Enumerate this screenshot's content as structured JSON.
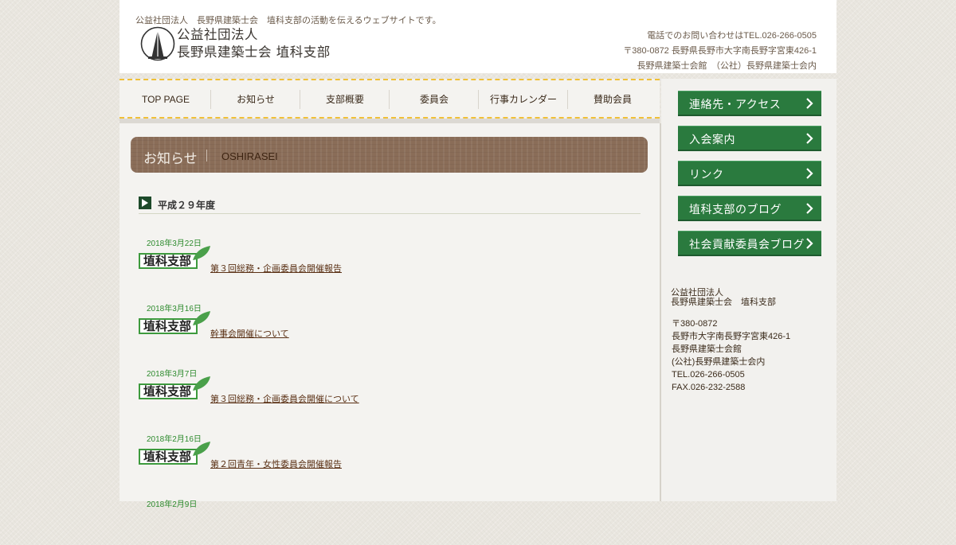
{
  "header": {
    "tagline": "公益社団法人　長野県建築士会　埴科支部の活動を伝えるウェブサイトです。",
    "logo_line1": "公益社団法人",
    "logo_line2": "長野県建築士会 埴科支部",
    "contact": [
      "電話でのお問い合わせはTEL.026-266-0505",
      "〒380-0872 長野県長野市大字南長野字宮東426-1",
      "長野県建築士会館　（公社）長野県建築士会内"
    ]
  },
  "nav": {
    "items": [
      "TOP PAGE",
      "お知らせ",
      "支部概要",
      "委員会",
      "行事カレンダー",
      "賛助会員"
    ]
  },
  "main": {
    "banner_title": "お知らせ",
    "banner_sub": "OSHIRASEI",
    "section_title": "平成２９年度",
    "tag_label": "埴科支部",
    "news": [
      {
        "date": "2018年3月22日",
        "title": "第３回総務・企画委員会開催報告"
      },
      {
        "date": "2018年3月16日",
        "title": "幹事会開催について"
      },
      {
        "date": "2018年3月7日",
        "title": "第３回総務・企画委員会開催について"
      },
      {
        "date": "2018年2月16日",
        "title": "第２回青年・女性委員会開催報告"
      },
      {
        "date": "2018年2月9日",
        "title": ""
      }
    ]
  },
  "sidebar": {
    "buttons": [
      "連絡先・アクセス",
      "入会案内",
      "リンク",
      "埴科支部のブログ",
      "社会貢献委員会ブログ"
    ],
    "org": [
      "公益社団法人",
      "長野県建築士会　埴科支部"
    ],
    "address": [
      "〒380-0872",
      "長野市大字南長野字宮東426-1",
      "長野県建築士会館",
      "(公社)長野県建築士会内",
      "TEL.026-266-0505",
      "FAX.026-232-2588"
    ]
  },
  "colors": {
    "accent_green": "#2a7a3e",
    "nav_dash": "#f0c038",
    "banner_brown": "#8a6d58",
    "date_green": "#2e8b2e"
  }
}
